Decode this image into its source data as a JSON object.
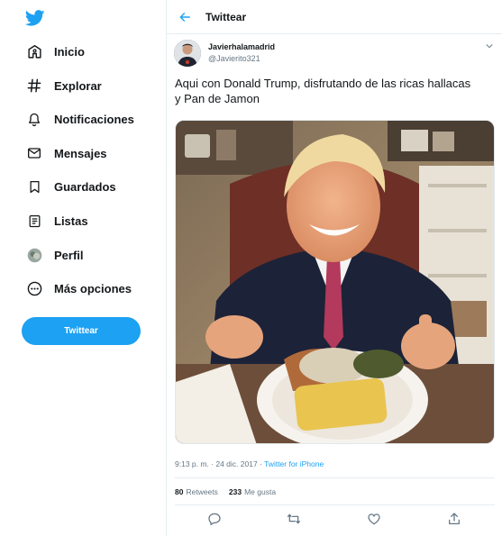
{
  "sidebar": {
    "logo_icon": "twitter-bird-icon",
    "items": [
      {
        "label": "Inicio",
        "icon": "home-icon"
      },
      {
        "label": "Explorar",
        "icon": "hashtag-icon"
      },
      {
        "label": "Notificaciones",
        "icon": "bell-icon"
      },
      {
        "label": "Mensajes",
        "icon": "envelope-icon"
      },
      {
        "label": "Guardados",
        "icon": "bookmark-icon"
      },
      {
        "label": "Listas",
        "icon": "list-icon"
      },
      {
        "label": "Perfil",
        "icon": "avatar-icon"
      },
      {
        "label": "Más opciones",
        "icon": "more-circle-icon"
      }
    ],
    "tweet_button": "Twittear"
  },
  "header": {
    "title": "Twittear"
  },
  "tweet": {
    "author_name": "Javierhalamadrid",
    "author_handle": "@Javierito321",
    "text": "Aqui con Donald Trump, disfrutando de las ricas hallacas y Pan de Jamon",
    "time": "9:13 p. m. · 24 dic. 2017",
    "separator": " · ",
    "source": "Twitter for iPhone",
    "retweets_count": "80",
    "retweets_label": "Retweets",
    "likes_count": "233",
    "likes_label": "Me gusta"
  },
  "colors": {
    "accent": "#1da1f2",
    "text": "#14171a",
    "muted": "#657786"
  }
}
